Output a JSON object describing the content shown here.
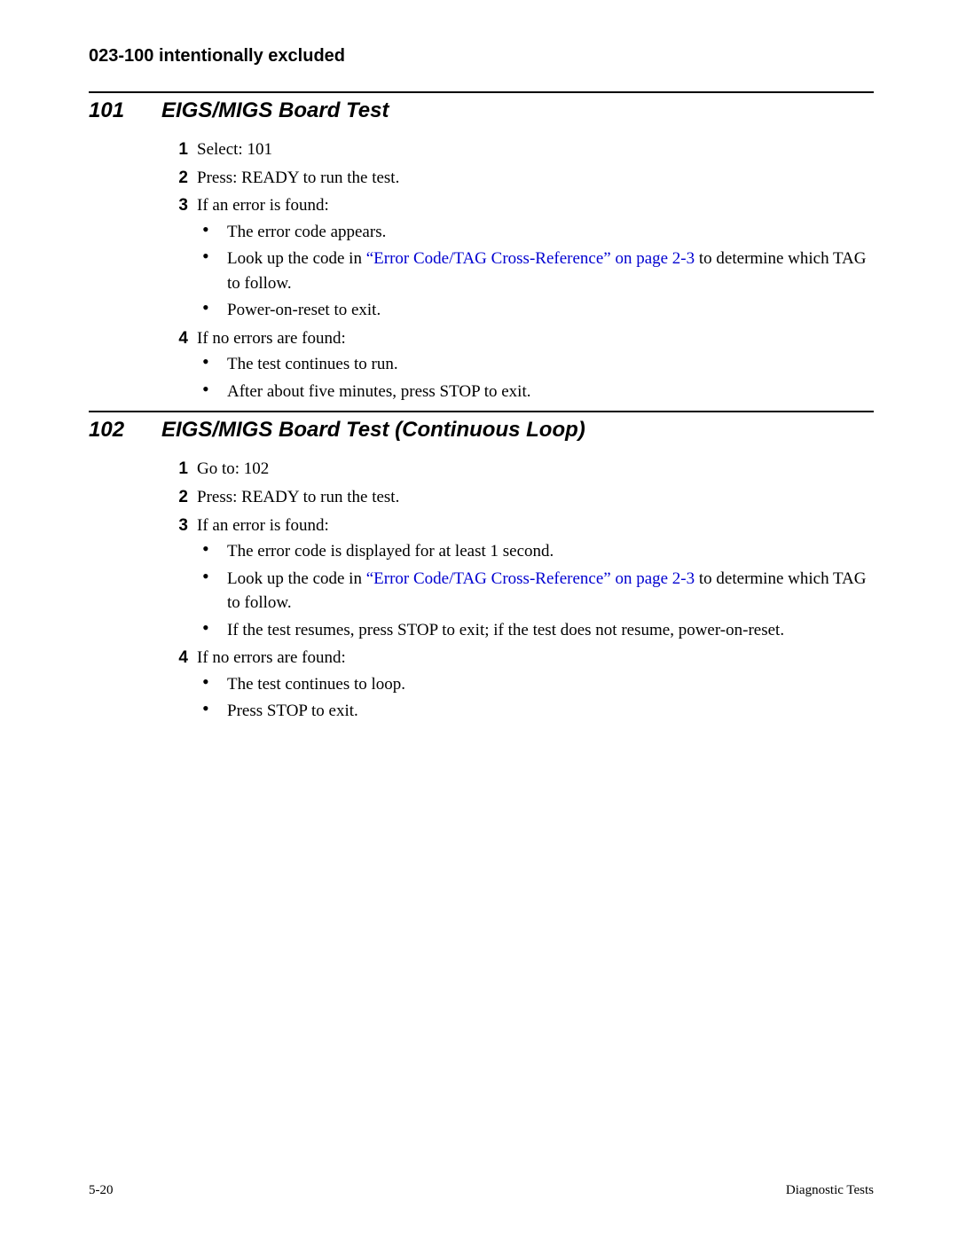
{
  "excluded_note": "023-100 intentionally excluded",
  "sections": [
    {
      "num": "101",
      "title": "EIGS/MIGS Board Test",
      "steps": [
        {
          "text": "Select: 101"
        },
        {
          "text": "Press: READY to run the test."
        },
        {
          "text": "If an error is found:",
          "bullets": [
            {
              "pre": "The error code appears.",
              "link": "",
              "post": ""
            },
            {
              "pre": "Look up the code in ",
              "link": "“Error Code/TAG Cross-Reference” on page 2-3",
              "post": " to determine which TAG to follow."
            },
            {
              "pre": "Power-on-reset to exit.",
              "link": "",
              "post": ""
            }
          ]
        },
        {
          "text": "If no errors are found:",
          "bullets": [
            {
              "pre": "The test continues to run.",
              "link": "",
              "post": ""
            },
            {
              "pre": "After about five minutes, press STOP to exit.",
              "link": "",
              "post": ""
            }
          ]
        }
      ]
    },
    {
      "num": "102",
      "title": "EIGS/MIGS Board Test (Continuous Loop)",
      "steps": [
        {
          "text": "Go to: 102"
        },
        {
          "text": "Press: READY to run the test."
        },
        {
          "text": "If an error is found:",
          "bullets": [
            {
              "pre": "The error code is displayed for at least 1 second.",
              "link": "",
              "post": ""
            },
            {
              "pre": "Look up the code in ",
              "link": "“Error Code/TAG Cross-Reference” on page 2-3",
              "post": " to determine which TAG to follow."
            },
            {
              "pre": "If the test resumes, press STOP to exit; if the test does not resume, power-on-reset.",
              "link": "",
              "post": ""
            }
          ]
        },
        {
          "text": "If no errors are found:",
          "bullets": [
            {
              "pre": "The test continues to loop.",
              "link": "",
              "post": ""
            },
            {
              "pre": "Press STOP to exit.",
              "link": "",
              "post": ""
            }
          ]
        }
      ]
    }
  ],
  "footer": {
    "left": "5-20",
    "right": "Diagnostic Tests"
  }
}
